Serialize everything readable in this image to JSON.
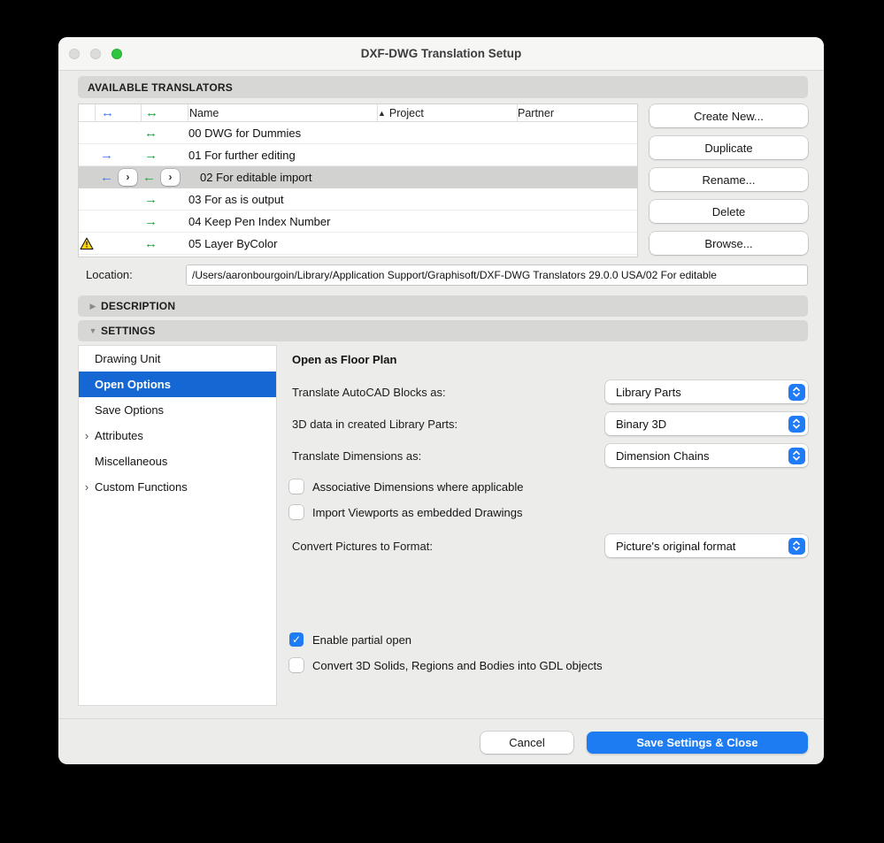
{
  "window": {
    "title": "DXF-DWG Translation Setup"
  },
  "colors": {
    "accent_blue": "#1f7cf5",
    "nav_selection_blue": "#1568d4",
    "arrow_blue": "#3b7af0",
    "arrow_green": "#18a23b",
    "warning_yellow": "#ffd60a"
  },
  "translators": {
    "header": "AVAILABLE TRANSLATORS",
    "table": {
      "columns": {
        "blue_icon": "↔",
        "green_icon": "↔",
        "name": "Name",
        "sort_icon": "▲",
        "project": "Project",
        "partner": "Partner"
      },
      "rows": [
        {
          "name": "00 DWG for Dummies",
          "blue": "",
          "green": "↔",
          "warning": false,
          "selected": false
        },
        {
          "name": "01 For further editing",
          "blue": "→",
          "green": "→",
          "warning": false,
          "selected": false
        },
        {
          "name": "02 For editable import",
          "blue": "←",
          "green": "←",
          "warning": false,
          "selected": true,
          "expander": "›"
        },
        {
          "name": "03 For as is output",
          "blue": "",
          "green": "→",
          "warning": false,
          "selected": false
        },
        {
          "name": "04 Keep Pen Index Number",
          "blue": "",
          "green": "→",
          "warning": false,
          "selected": false
        },
        {
          "name": "05 Layer ByColor",
          "blue": "",
          "green": "↔",
          "warning": true,
          "selected": false
        }
      ]
    },
    "actions": {
      "create": "Create New...",
      "duplicate": "Duplicate",
      "rename": "Rename...",
      "delete": "Delete",
      "browse": "Browse..."
    }
  },
  "location": {
    "label": "Location:",
    "value": "/Users/aaronbourgoin/Library/Application Support/Graphisoft/DXF-DWG Translators 29.0.0 USA/02 For editable"
  },
  "sections": {
    "description": {
      "label": "DESCRIPTION",
      "arrow": "▶",
      "expanded": false
    },
    "settings": {
      "label": "SETTINGS",
      "arrow": "▼",
      "expanded": true
    }
  },
  "settings_nav": {
    "items": [
      {
        "label": "Drawing Unit",
        "chevron": "",
        "selected": false
      },
      {
        "label": "Open Options",
        "chevron": "",
        "selected": true
      },
      {
        "label": "Save Options",
        "chevron": "",
        "selected": false
      },
      {
        "label": "Attributes",
        "chevron": "›",
        "selected": false
      },
      {
        "label": "Miscellaneous",
        "chevron": "",
        "selected": false
      },
      {
        "label": "Custom Functions",
        "chevron": "›",
        "selected": false
      }
    ]
  },
  "open_options": {
    "heading": "Open as Floor Plan",
    "fields": [
      {
        "label": "Translate AutoCAD Blocks as:",
        "value": "Library Parts"
      },
      {
        "label": "3D data in created Library Parts:",
        "value": "Binary 3D"
      },
      {
        "label": "Translate Dimensions as:",
        "value": "Dimension Chains"
      }
    ],
    "checkboxes_mid": [
      {
        "label": "Associative Dimensions where applicable",
        "checked": false
      },
      {
        "label": "Import Viewports as embedded Drawings",
        "checked": false
      }
    ],
    "pictures_field": {
      "label": "Convert Pictures to Format:",
      "value": "Picture's original format"
    },
    "checkboxes_bottom": [
      {
        "label": "Enable partial open",
        "checked": true
      },
      {
        "label": "Convert 3D Solids, Regions and Bodies into GDL objects",
        "checked": false
      }
    ]
  },
  "footer": {
    "cancel": "Cancel",
    "save": "Save Settings & Close"
  }
}
